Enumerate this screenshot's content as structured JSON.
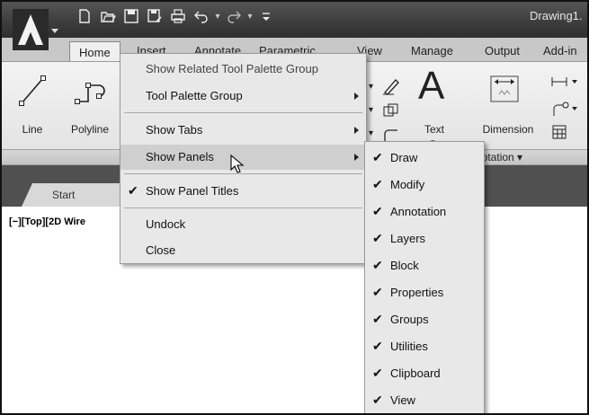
{
  "window": {
    "title": "Drawing1."
  },
  "quick_access": {
    "icons": [
      "new-icon",
      "open-icon",
      "save-icon",
      "save-as-icon",
      "plot-icon",
      "undo-icon",
      "redo-icon",
      "customize-icon"
    ]
  },
  "ribbon": {
    "tabs": [
      "Home",
      "Insert",
      "Annotate",
      "Parametric",
      "View",
      "Manage",
      "Output",
      "Add-in"
    ],
    "tools": {
      "line": "Line",
      "polyline": "Polyline",
      "text": "Text",
      "dimension": "Dimension"
    },
    "panel_annotation": "notation ▾"
  },
  "file_tabs": {
    "start": "Start"
  },
  "viewport": {
    "controls": "[−][Top][2D Wire"
  },
  "context_menu": {
    "items": [
      {
        "label": "Show Related Tool Palette Group",
        "checked": false,
        "submenu": false,
        "enabled": false
      },
      {
        "label": "Tool Palette Group",
        "checked": false,
        "submenu": true,
        "enabled": true
      },
      {
        "label": "Show Tabs",
        "checked": false,
        "submenu": true,
        "enabled": true
      },
      {
        "label": "Show Panels",
        "checked": false,
        "submenu": true,
        "enabled": true,
        "highlighted": true
      },
      {
        "label": "Show Panel Titles",
        "checked": true,
        "submenu": false,
        "enabled": true
      },
      {
        "label": "Undock",
        "checked": false,
        "submenu": false,
        "enabled": true
      },
      {
        "label": "Close",
        "checked": false,
        "submenu": false,
        "enabled": true
      }
    ],
    "check_glyph": "✔"
  },
  "panels_submenu": {
    "items": [
      {
        "label": "Draw",
        "checked": true
      },
      {
        "label": "Modify",
        "checked": true
      },
      {
        "label": "Annotation",
        "checked": true
      },
      {
        "label": "Layers",
        "checked": true
      },
      {
        "label": "Block",
        "checked": true
      },
      {
        "label": "Properties",
        "checked": true
      },
      {
        "label": "Groups",
        "checked": true
      },
      {
        "label": "Utilities",
        "checked": true
      },
      {
        "label": "Clipboard",
        "checked": true
      },
      {
        "label": "View",
        "checked": true
      }
    ]
  }
}
